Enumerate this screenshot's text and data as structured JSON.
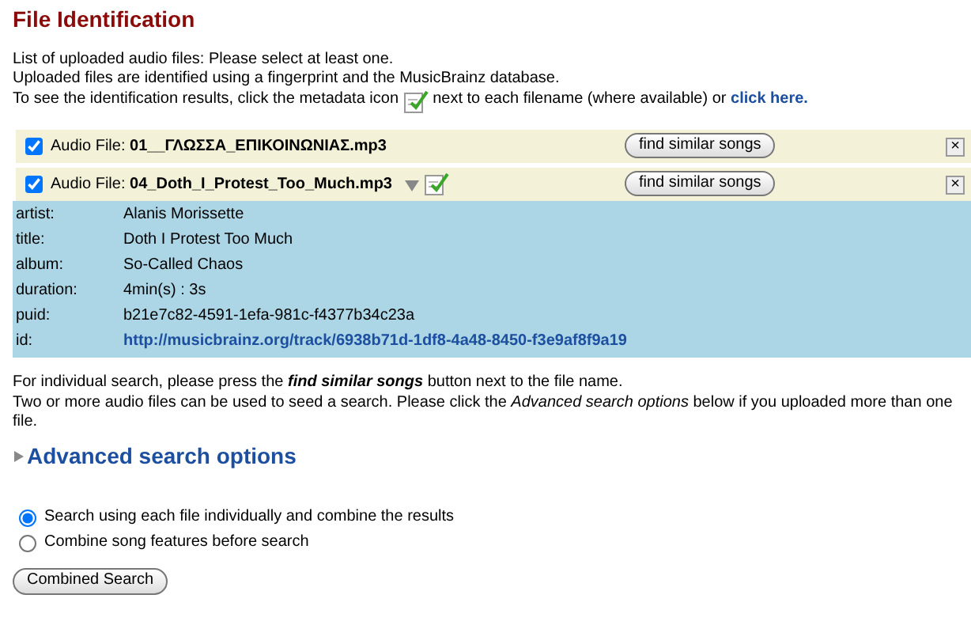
{
  "title": "File Identification",
  "intro": [
    "List of uploaded audio files: Please select at least one.",
    "Uploaded files are identified using a fingerprint and the MusicBrainz database."
  ],
  "intro_icon_line": {
    "before": "To see the identification results, click the metadata icon",
    "after": "next to each filename (where available) or",
    "link": "click here."
  },
  "files": [
    {
      "checked": true,
      "label": "Audio File:",
      "filename": "01__ΓΛΩΣΣΑ_ΕΠΙΚΟΙΝΩΝΙΑΣ.mp3",
      "button": "find similar songs",
      "close": "×"
    },
    {
      "checked": true,
      "label": "Audio File:",
      "filename": "04_Doth_I_Protest_Too_Much.mp3",
      "button": "find similar songs",
      "close": "×",
      "metadata": [
        {
          "key": "artist:",
          "value": "Alanis Morissette"
        },
        {
          "key": "title:",
          "value": "Doth I Protest Too Much"
        },
        {
          "key": "album:",
          "value": "So-Called Chaos"
        },
        {
          "key": "duration:",
          "value": "4min(s) : 3s"
        },
        {
          "key": "puid:",
          "value": "b21e7c82-4591-1efa-981c-f4377b34c23a"
        },
        {
          "key": "id:",
          "value": "http://musicbrainz.org/track/6938b71d-1df8-4a48-8450-f3e9af8f9a19",
          "kind": "link"
        }
      ]
    }
  ],
  "help": [
    "For individual search, please press the **find similar songs** button next to the file name.",
    "Two or more audio files can be used to seed a search. Please click the *Advanced search options* below if you uploaded more than one file."
  ],
  "advanced": {
    "label": "Advanced search options",
    "expanded": false
  },
  "options": [
    {
      "label": "Search using each file individually and combine the results",
      "selected": true
    },
    {
      "label": "Combine song features before search",
      "selected": false
    }
  ],
  "submit": "Combined Search"
}
